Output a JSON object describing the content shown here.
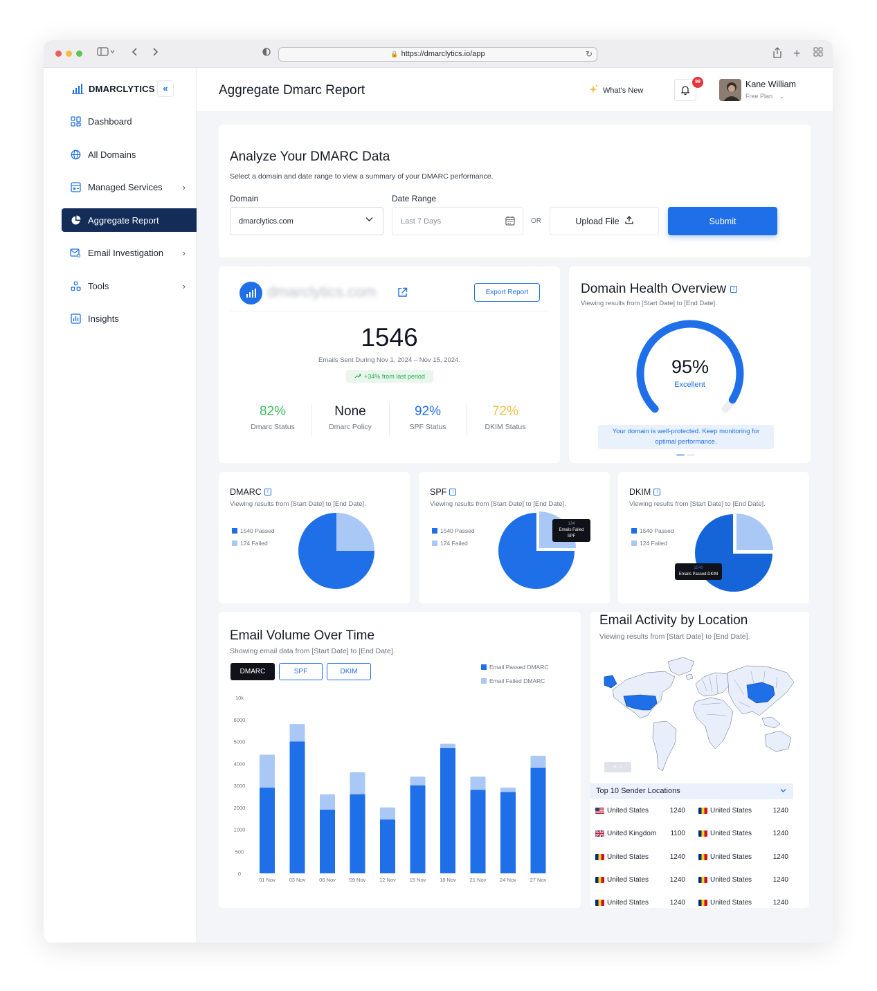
{
  "browser": {
    "url": "https://dmarclytics.io/app"
  },
  "sidebar": {
    "logo": "DMARCLYTICS",
    "collapse_icon": "double-chevron-left-icon",
    "items": [
      {
        "label": "Dashboard",
        "icon": "grid-icon",
        "chevron": false
      },
      {
        "label": "All Domains",
        "icon": "globe-icon",
        "chevron": false
      },
      {
        "label": "Managed Services",
        "icon": "services-icon",
        "chevron": true
      },
      {
        "label": "Aggregate Report",
        "icon": "pie-icon",
        "chevron": false,
        "active": true
      },
      {
        "label": "Email Investigation",
        "icon": "mail-search-icon",
        "chevron": true
      },
      {
        "label": "Tools",
        "icon": "tools-icon",
        "chevron": true
      },
      {
        "label": "Insights",
        "icon": "bar-chart-icon",
        "chevron": false
      }
    ]
  },
  "header": {
    "title": "Aggregate Dmarc Report",
    "whats_new": "What's New",
    "notification_count": "99",
    "user_name": "Kane William",
    "user_plan": "Free Plan"
  },
  "analyze": {
    "title": "Analyze Your DMARC Data",
    "subtitle": "Select a domain and date range to view a summary of your DMARC performance.",
    "domain_label": "Domain",
    "domain_value": "dmarclytics.com",
    "date_label": "Date Range",
    "date_placeholder": "Last 7 Days",
    "or": "OR",
    "upload": "Upload File",
    "submit": "Submit"
  },
  "summary": {
    "domain": "dmarclytics.com",
    "export": "Export Report",
    "total": "1546",
    "total_caption": "Emails Sent During Nov 1, 2024 – Nov 15, 2024.",
    "trend": "+34% from last period",
    "stats": [
      {
        "value": "82%",
        "label": "Dmarc Status",
        "color": "#3dbb5e"
      },
      {
        "value": "None",
        "label": "Dmarc Policy",
        "color": "#161c28"
      },
      {
        "value": "92%",
        "label": "SPF Status",
        "color": "#1e6fe8"
      },
      {
        "value": "72%",
        "label": "DKIM Status",
        "color": "#f2c14a"
      }
    ]
  },
  "health": {
    "title": "Domain Health Overview",
    "subtitle": "Viewing results from [Start Date] to [End Date].",
    "score": "95%",
    "score_value": 95,
    "rating": "Excellent",
    "message": "Your domain is well-protected. Keep monitoring for optimal performance."
  },
  "auth_cards": [
    {
      "title": "DMARC",
      "subtitle": "Viewing results from [Start Date] to [End Date].",
      "passed": "1540 Passed",
      "failed": "124 Failed",
      "tooltip": null
    },
    {
      "title": "SPF",
      "subtitle": "Viewing results from [Start Date] to [End Date].",
      "passed": "1540 Passed",
      "failed": "124 Failed",
      "tooltip": {
        "value": "124",
        "label": "Emails Failed SPF"
      }
    },
    {
      "title": "DKIM",
      "subtitle": "Viewing results from [Start Date] to [End Date].",
      "passed": "1540 Passed",
      "failed": "124 Failed",
      "tooltip": {
        "value": "1540",
        "label": "Emails Passed DKIM"
      }
    }
  ],
  "volume": {
    "title": "Email Volume Over Time",
    "subtitle": "Showing email data from [Start Date] to [End Date].",
    "tabs": [
      "DMARC",
      "SPF",
      "DKIM"
    ],
    "legend_passed": "Email Passed DMARC",
    "legend_failed": "Email Failed DMARC"
  },
  "chart_data": {
    "type": "bar",
    "stacked": true,
    "categories": [
      "01 Nov",
      "03 Nov",
      "06 Nov",
      "09 Nov",
      "12 Nov",
      "15 Nov",
      "18 Nov",
      "21 Nov",
      "24 Nov",
      "27 Nov"
    ],
    "y_ticks": [
      "0",
      "500",
      "1000",
      "2000",
      "3000",
      "4000",
      "5000",
      "6000",
      "10k"
    ],
    "series": [
      {
        "name": "Email Passed DMARC",
        "color": "#1e6fe8",
        "values": [
          2900,
          5000,
          1900,
          2600,
          1450,
          3000,
          4700,
          2800,
          2700,
          3800
        ]
      },
      {
        "name": "Email Failed DMARC",
        "color": "#a9c8f5",
        "values": [
          1500,
          800,
          700,
          1000,
          550,
          400,
          200,
          600,
          200,
          550
        ]
      }
    ]
  },
  "location": {
    "title": "Email Activity by Location",
    "subtitle": "Viewing results from [Start Date] to [End Date].",
    "zoom": "+ −",
    "dropdown": "Top 10 Sender Locations",
    "rows": [
      [
        {
          "country": "United States",
          "count": "1240",
          "flag": "us"
        },
        {
          "country": "United States",
          "count": "1240",
          "flag": "ro"
        }
      ],
      [
        {
          "country": "United Kingdom",
          "count": "1100",
          "flag": "uk"
        },
        {
          "country": "United States",
          "count": "1240",
          "flag": "ro"
        }
      ],
      [
        {
          "country": "United States",
          "count": "1240",
          "flag": "ro"
        },
        {
          "country": "United States",
          "count": "1240",
          "flag": "ro"
        }
      ],
      [
        {
          "country": "United States",
          "count": "1240",
          "flag": "ro"
        },
        {
          "country": "United States",
          "count": "1240",
          "flag": "ro"
        }
      ],
      [
        {
          "country": "United States",
          "count": "1240",
          "flag": "ro"
        },
        {
          "country": "United States",
          "count": "1240",
          "flag": "ro"
        }
      ]
    ]
  }
}
